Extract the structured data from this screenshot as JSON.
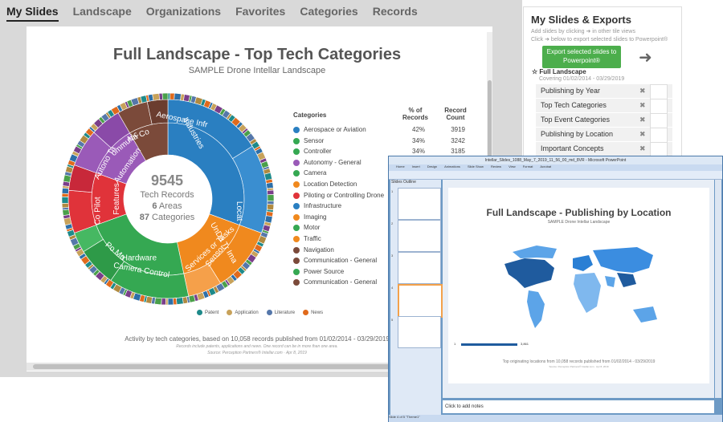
{
  "nav": {
    "tabs": [
      "My Slides",
      "Landscape",
      "Organizations",
      "Favorites",
      "Categories",
      "Records"
    ],
    "active": "My Slides"
  },
  "chart": {
    "title": "Full Landscape - Top Tech Categories",
    "subtitle": "SAMPLE Drone Intellar Landscape",
    "center": {
      "total": "9545",
      "total_label": "Tech Records",
      "areas": "6",
      "areas_label": "Areas",
      "categories": "87",
      "categories_label": "Categories"
    },
    "legend_header": {
      "categories": "Categories",
      "pct": "% of Records",
      "count": "Record Count"
    },
    "footer": "Activity by tech categories, based on 10,058 records published from 01/02/2014 - 03/29/2019",
    "footnote": "Records include patents, applications and news. One record can be in more than one area.",
    "source": "Source: Perception Partners® Intellar.com · Apr 8, 2019",
    "record_types": [
      {
        "name": "Patent",
        "color": "#1e8a8a"
      },
      {
        "name": "Application",
        "color": "#c8a25a"
      },
      {
        "name": "Literature",
        "color": "#5577aa"
      },
      {
        "name": "News",
        "color": "#e06a1c"
      }
    ],
    "inner_labels": [
      "Industries",
      "Services or Tasks",
      "Hardware",
      "Features",
      "Automation",
      "Autono Ta",
      "Co Pilot",
      "Aerospace Infr",
      "Na Co",
      "ommunic",
      "Locat",
      "UnDa Tr Ima",
      "Sensor",
      "Po Mo",
      "Camera Control"
    ]
  },
  "chart_data": {
    "type": "pie",
    "title": "Full Landscape - Top Tech Categories",
    "subtitle": "SAMPLE Drone Intellar Landscape",
    "series": [
      {
        "name": "Aerospace or Aviation",
        "pct": 42,
        "count": 3919,
        "color": "#2a7fc1"
      },
      {
        "name": "Sensor",
        "pct": 34,
        "count": 3242,
        "color": "#35a852"
      },
      {
        "name": "Controller",
        "pct": 34,
        "count": 3185,
        "color": "#35a852"
      },
      {
        "name": "Autonomy - General",
        "pct": null,
        "count": null,
        "color": "#9a5ab8"
      },
      {
        "name": "Camera",
        "pct": null,
        "count": null,
        "color": "#35a852"
      },
      {
        "name": "Location Detection",
        "pct": null,
        "count": null,
        "color": "#f0891e"
      },
      {
        "name": "Piloting or Controlling Drone",
        "pct": null,
        "count": null,
        "color": "#e0333a"
      },
      {
        "name": "Infrastructure",
        "pct": null,
        "count": null,
        "color": "#2a7fc1"
      },
      {
        "name": "Imaging",
        "pct": null,
        "count": null,
        "color": "#f0891e"
      },
      {
        "name": "Motor",
        "pct": null,
        "count": null,
        "color": "#35a852"
      },
      {
        "name": "Traffic",
        "pct": null,
        "count": null,
        "color": "#f0891e"
      },
      {
        "name": "Navigation",
        "pct": null,
        "count": null,
        "color": "#7b4a3a"
      },
      {
        "name": "Communication - General",
        "pct": null,
        "count": null,
        "color": "#7b4a3a"
      },
      {
        "name": "Power Source",
        "pct": null,
        "count": null,
        "color": "#35a852"
      },
      {
        "name": "Communication - General",
        "pct": null,
        "count": null,
        "color": "#7b4a3a"
      }
    ]
  },
  "sidebar": {
    "title": "My Slides & Exports",
    "hint1": "Add slides by clicking ➜ in other tile views",
    "hint2": "Click ➜ below to export selected slides to Powerpoint®",
    "export_label": "Export selected slides to Powerpoint®",
    "group": "Full Landscape",
    "covering": "Covering 01/02/2014 - 03/29/2019",
    "slides": [
      "Publishing by Year",
      "Top Tech Categories",
      "Top Event Categories",
      "Publishing by Location",
      "Important Concepts"
    ]
  },
  "ppt": {
    "window_title": "Intellar_Slides_1088_May_7_2019_11_56_00_md_8VR - Microsoft PowerPoint",
    "menus": [
      "Home",
      "Insert",
      "Design",
      "Animations",
      "Slide Show",
      "Review",
      "View",
      "Format",
      "Acrobat"
    ],
    "panel_tabs": "Slides  Outline",
    "thumb_numbers": [
      "1",
      "2",
      "3",
      "4",
      "5"
    ],
    "slide_title": "Full Landscape - Publishing by Location",
    "slide_subtitle": "SAMPLE Drone Intellar Landscape",
    "slide_footer": "Top originating locations from 10,058 records published from 01/02/2014 - 03/29/2019",
    "slide_source": "Source: Perception Partners® Intellar.com · Apr 8, 2019",
    "bar_min": "1",
    "bar_max": "3,861",
    "notes_placeholder": "Click to add notes",
    "status": "Slide 4 of 5   \"Theme1\""
  }
}
